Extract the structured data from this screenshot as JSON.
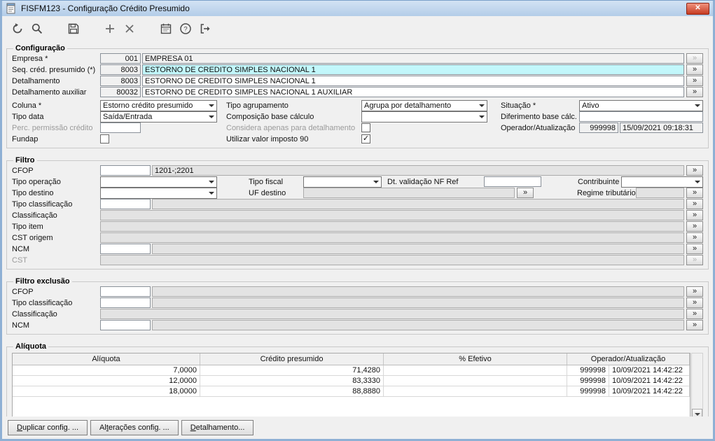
{
  "colors": {
    "frame": "#8fb0d4",
    "titlebar": "#bdd4ec",
    "close_button": "#c63b22",
    "highlight_field": "#c2f7fb"
  },
  "window": {
    "title": "FISFM123 - Configuração Crédito Presumido",
    "close_label": "✕"
  },
  "more_label": "»",
  "configuracao": {
    "legend": "Configuração",
    "empresa": {
      "label": "Empresa *",
      "code": "001",
      "desc": "EMPRESA 01"
    },
    "seq": {
      "label": "Seq. créd. presumido (*)",
      "code": "8003",
      "desc": "ESTORNO DE CREDITO SIMPLES NACIONAL 1"
    },
    "detalhamento": {
      "label": "Detalhamento",
      "code": "8003",
      "desc": "ESTORNO DE CREDITO SIMPLES NACIONAL 1"
    },
    "detalhamento_auxiliar": {
      "label": "Detalhamento auxiliar",
      "code": "80032",
      "desc": "ESTORNO DE CREDITO SIMPLES NACIONAL 1 AUXILIAR"
    },
    "coluna": {
      "label": "Coluna *",
      "value": "Estorno crédito presumido"
    },
    "tipo_agrupamento": {
      "label": "Tipo agrupamento",
      "value": "Agrupa por detalhamento"
    },
    "situacao": {
      "label": "Situação *",
      "value": "Ativo"
    },
    "tipo_data": {
      "label": "Tipo data",
      "value": "Saída/Entrada"
    },
    "composicao_base": {
      "label": "Composição base cálculo",
      "value": ""
    },
    "diferimento_base": {
      "label": "Diferimento base cálc.",
      "value": ""
    },
    "perc_permissao": {
      "label": "Perc. permissão crédito",
      "value": ""
    },
    "considera_detalhamento": {
      "label": "Considera apenas para detalhamento",
      "check": ""
    },
    "operador_atualizacao": {
      "label": "Operador/Atualização",
      "operador": "999998",
      "data": "15/09/2021 09:18:31"
    },
    "fundap": {
      "label": "Fundap",
      "check": ""
    },
    "utilizar_imposto": {
      "label": "Utilizar valor imposto 90",
      "check": "✓"
    }
  },
  "filtro": {
    "legend": "Filtro",
    "cfop": {
      "label": "CFOP",
      "code": "",
      "desc": "1201-;2201"
    },
    "tipo_operacao": {
      "label": "Tipo operação",
      "value": ""
    },
    "tipo_fiscal": {
      "label": "Tipo fiscal",
      "value": ""
    },
    "dt_validacao": {
      "label": "Dt. validação NF Ref",
      "value": ""
    },
    "contribuinte": {
      "label": "Contribuinte",
      "value": ""
    },
    "tipo_destino": {
      "label": "Tipo destino",
      "value": ""
    },
    "uf_destino": {
      "label": "UF destino",
      "value": ""
    },
    "regime_tributario": {
      "label": "Regime tributário",
      "value": ""
    },
    "tipo_classificacao": {
      "label": "Tipo classificação",
      "code": "",
      "desc": ""
    },
    "classificacao": {
      "label": "Classificação",
      "desc": ""
    },
    "tipo_item": {
      "label": "Tipo item",
      "desc": ""
    },
    "cst_origem": {
      "label": "CST origem",
      "desc": ""
    },
    "ncm": {
      "label": "NCM",
      "code": "",
      "desc": ""
    },
    "cst": {
      "label": "CST",
      "desc": ""
    }
  },
  "filtro_exclusao": {
    "legend": "Filtro exclusão",
    "cfop": {
      "label": "CFOP",
      "code": "",
      "desc": ""
    },
    "tipo_classificacao": {
      "label": "Tipo classificação",
      "code": "",
      "desc": ""
    },
    "classificacao": {
      "label": "Classificação",
      "desc": ""
    },
    "ncm": {
      "label": "NCM",
      "code": "",
      "desc": ""
    }
  },
  "aliquota": {
    "legend": "Alíquota",
    "headers": [
      "Alíquota",
      "Crédito presumido",
      "% Efetivo",
      "Operador/Atualização"
    ],
    "rows": [
      {
        "aliquota": "7,0000",
        "credito": "71,4280",
        "efetivo": "",
        "operador": "999998",
        "data": "10/09/2021 14:42:22"
      },
      {
        "aliquota": "12,0000",
        "credito": "83,3330",
        "efetivo": "",
        "operador": "999998",
        "data": "10/09/2021 14:42:22"
      },
      {
        "aliquota": "18,0000",
        "credito": "88,8880",
        "efetivo": "",
        "operador": "999998",
        "data": "10/09/2021 14:42:22"
      }
    ]
  },
  "footer_buttons": [
    {
      "label": "Duplicar config. ...",
      "accel": 0
    },
    {
      "label": "Alterações config. ...",
      "accel": 2
    },
    {
      "label": "Detalhamento...",
      "accel": 0
    }
  ]
}
